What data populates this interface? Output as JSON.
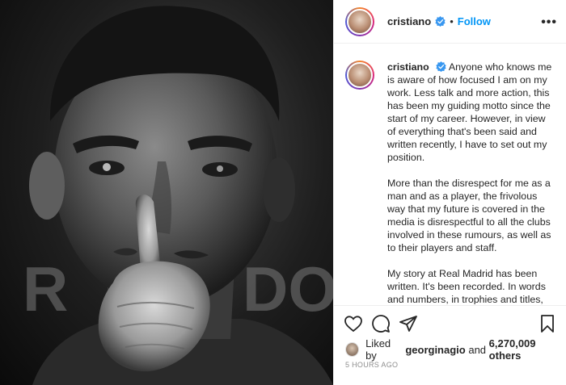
{
  "post": {
    "username": "cristiano",
    "follow_label": "Follow",
    "separator": "•",
    "more_label": "•••"
  },
  "caption": {
    "username": "cristiano",
    "paragraphs": [
      "Anyone who knows me is aware of how focused I am on my work. Less talk and more action, this has been my guiding motto since the start of my career. However, in view of everything that's been said and written recently, I have to set out my position.",
      "More than the disrespect for me as a man and as a player, the frivolous way that my future is covered in the media is disrespectful to all the clubs involved in these rumours, as well as to their players and staff.",
      "My story at Real Madrid has been written. It's been recorded. In words and numbers, in trophies and titles, in"
    ]
  },
  "likes": {
    "prefix": "Liked by",
    "user": "georginagio",
    "connector": "and",
    "count": "6,270,009 others"
  },
  "timestamp": "5 HOURS AGO",
  "photo": {
    "background_letters": "RO DO"
  },
  "icons": [
    "verified-badge-icon",
    "more-options-icon",
    "heart-icon",
    "comment-icon",
    "share-icon",
    "bookmark-icon"
  ],
  "colors": {
    "link": "#0095f6",
    "verified": "#3897f0",
    "muted": "#8e8e8e"
  }
}
